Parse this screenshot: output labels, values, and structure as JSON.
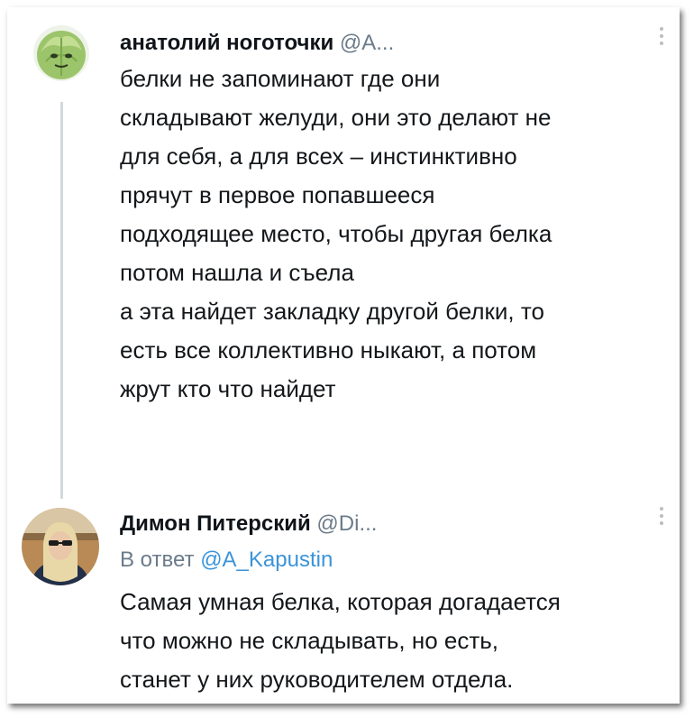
{
  "tweets": [
    {
      "author_name": "анатолий ноготочки",
      "handle": "@A...",
      "avatar_icon": "cabbage-avatar",
      "text": "белки не запоминают где они\nскладывают желуди, они это делают не\nдля себя, а для всех – инстинктивно\nпрячут в первое попавшееся\nподходящее место, чтобы другая белка\nпотом нашла и съела\nа эта найдет закладку другой белки, то\nесть все коллективно ныкают, а потом\nжрут кто что найдет"
    },
    {
      "author_name": "Димон Питерский",
      "handle": "@Di...",
      "avatar_icon": "man-sunglasses-avatar",
      "reply_prefix": "В ответ",
      "reply_to": "@A_Kapustin",
      "text": "Самая умная белка, которая догадается\nчто можно не складывать, но есть,\nстанет у них руководителем отдела."
    }
  ],
  "colors": {
    "text": "#14171a",
    "secondary": "#6b7b8a",
    "link": "#3b94d9",
    "thread_line": "#cfd9de"
  }
}
